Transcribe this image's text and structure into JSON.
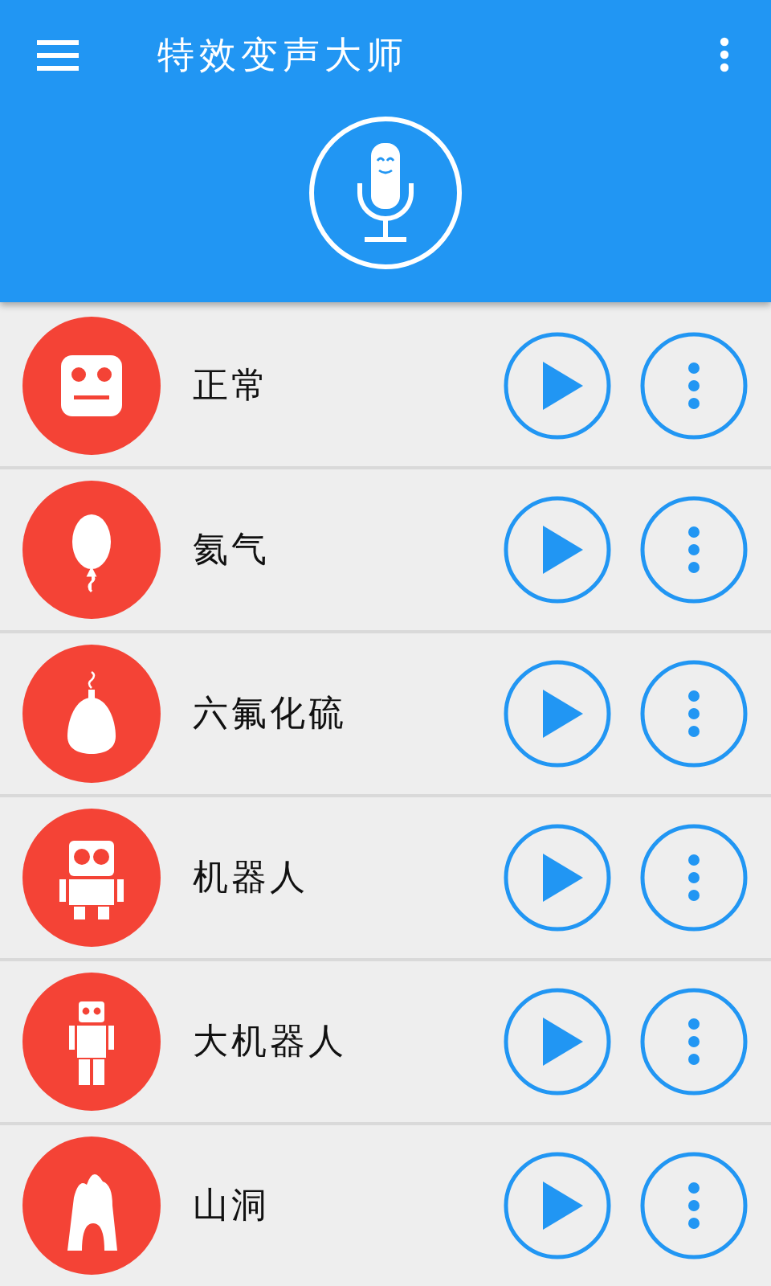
{
  "app_bar": {
    "title": "特效变声大师"
  },
  "effects": [
    {
      "label": "正常",
      "kind": "face"
    },
    {
      "label": "氦气",
      "kind": "balloon"
    },
    {
      "label": "六氟化硫",
      "kind": "weight"
    },
    {
      "label": "机器人",
      "kind": "robot"
    },
    {
      "label": "大机器人",
      "kind": "tall-robot"
    },
    {
      "label": "山洞",
      "kind": "cave"
    }
  ]
}
